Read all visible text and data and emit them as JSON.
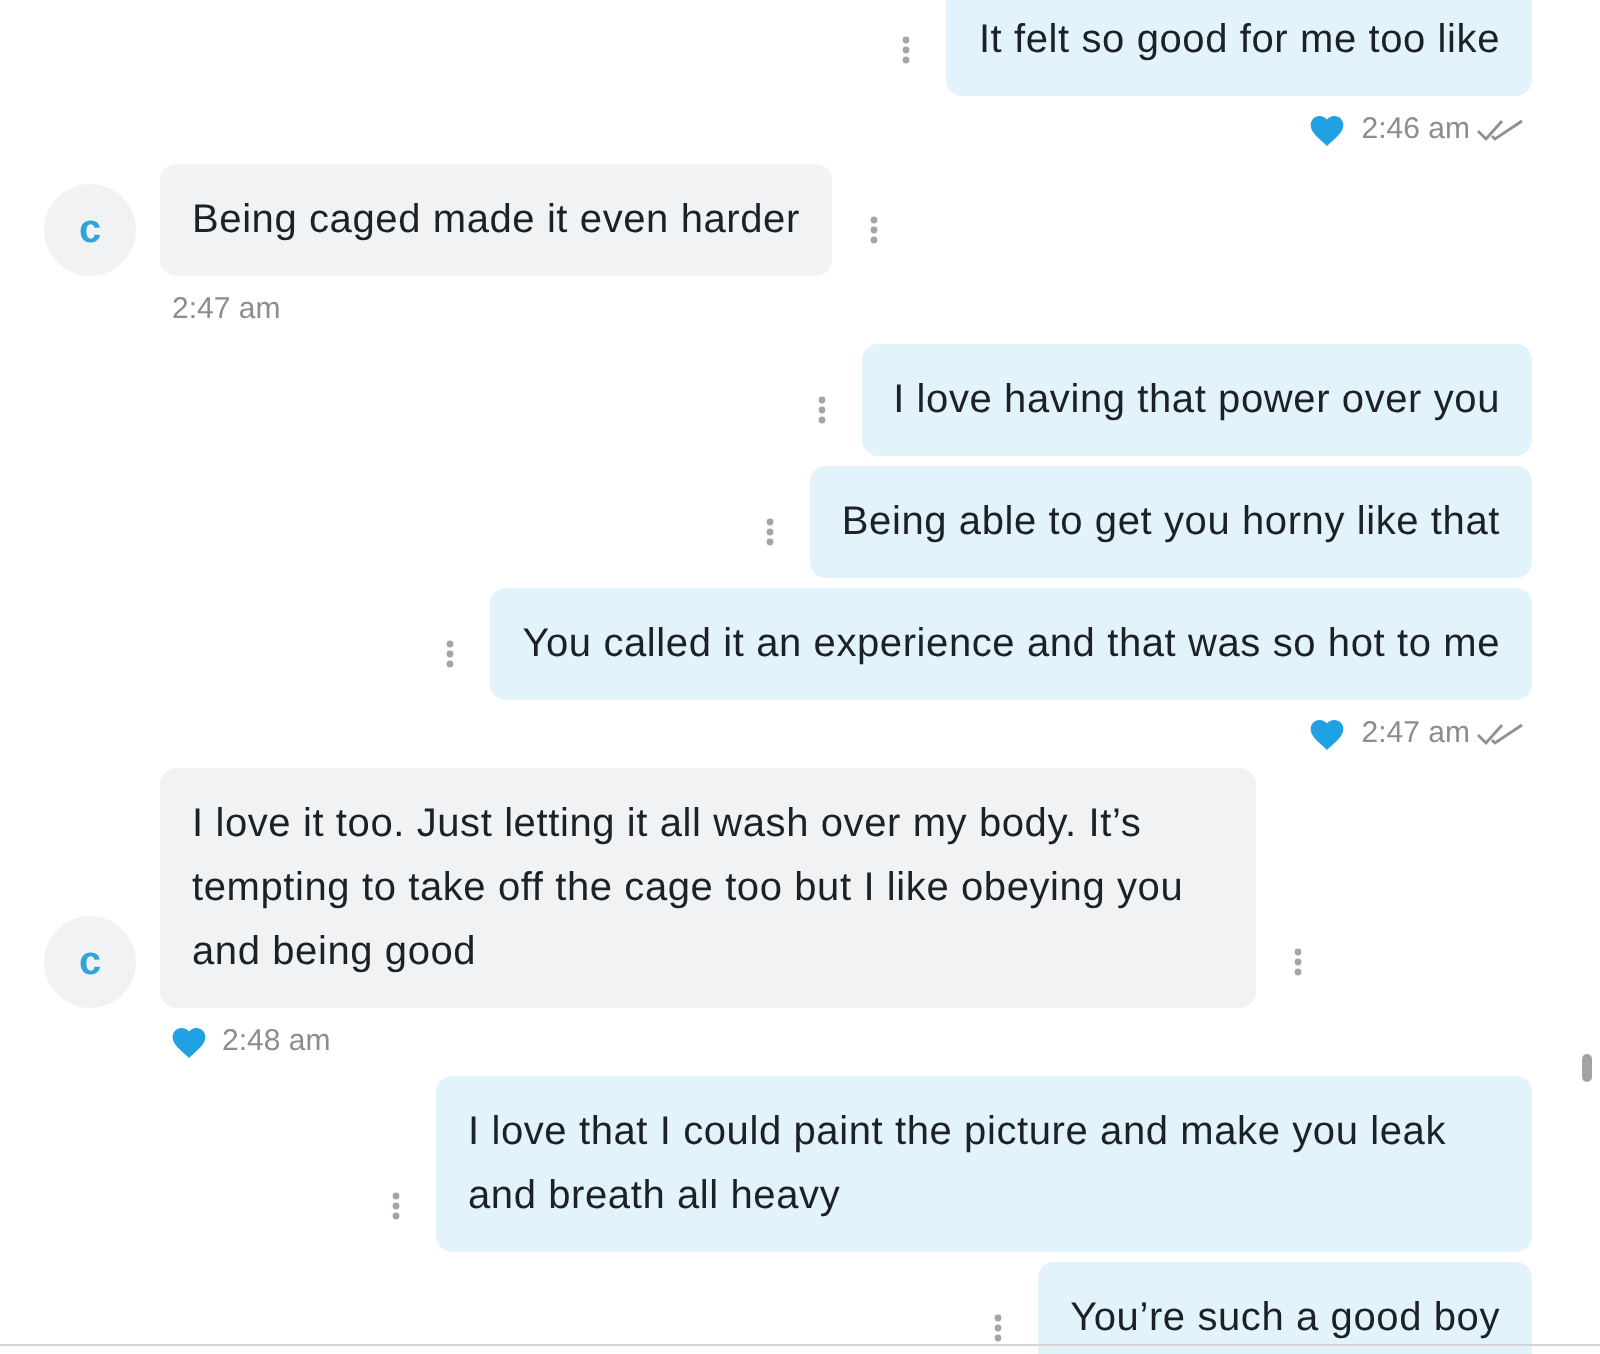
{
  "messages": [
    {
      "kind": "outgoing",
      "text": "It felt so good for me too like",
      "footer": {
        "liked": true,
        "time": "2:46 am",
        "read": true
      }
    },
    {
      "kind": "incoming",
      "avatar": "c",
      "text": "Being caged made it even harder",
      "footer": {
        "liked": false,
        "time": "2:47 am"
      }
    },
    {
      "kind": "outgoing",
      "text": "I love having that power over you"
    },
    {
      "kind": "outgoing",
      "text": "Being able to get you horny like that"
    },
    {
      "kind": "outgoing",
      "text": "You called it an experience and that was so hot to me",
      "footer": {
        "liked": true,
        "time": "2:47 am",
        "read": true
      }
    },
    {
      "kind": "incoming",
      "avatar": "c",
      "text": "I love it too. Just letting it all wash over my body. It’s tempting to take off the cage too but I like obeying you and being good",
      "footer": {
        "liked": true,
        "time": "2:48 am"
      }
    },
    {
      "kind": "outgoing",
      "text": "I love that I could paint the picture and make you leak and breath all heavy"
    },
    {
      "kind": "outgoing",
      "text": "You’re such a good boy"
    }
  ]
}
